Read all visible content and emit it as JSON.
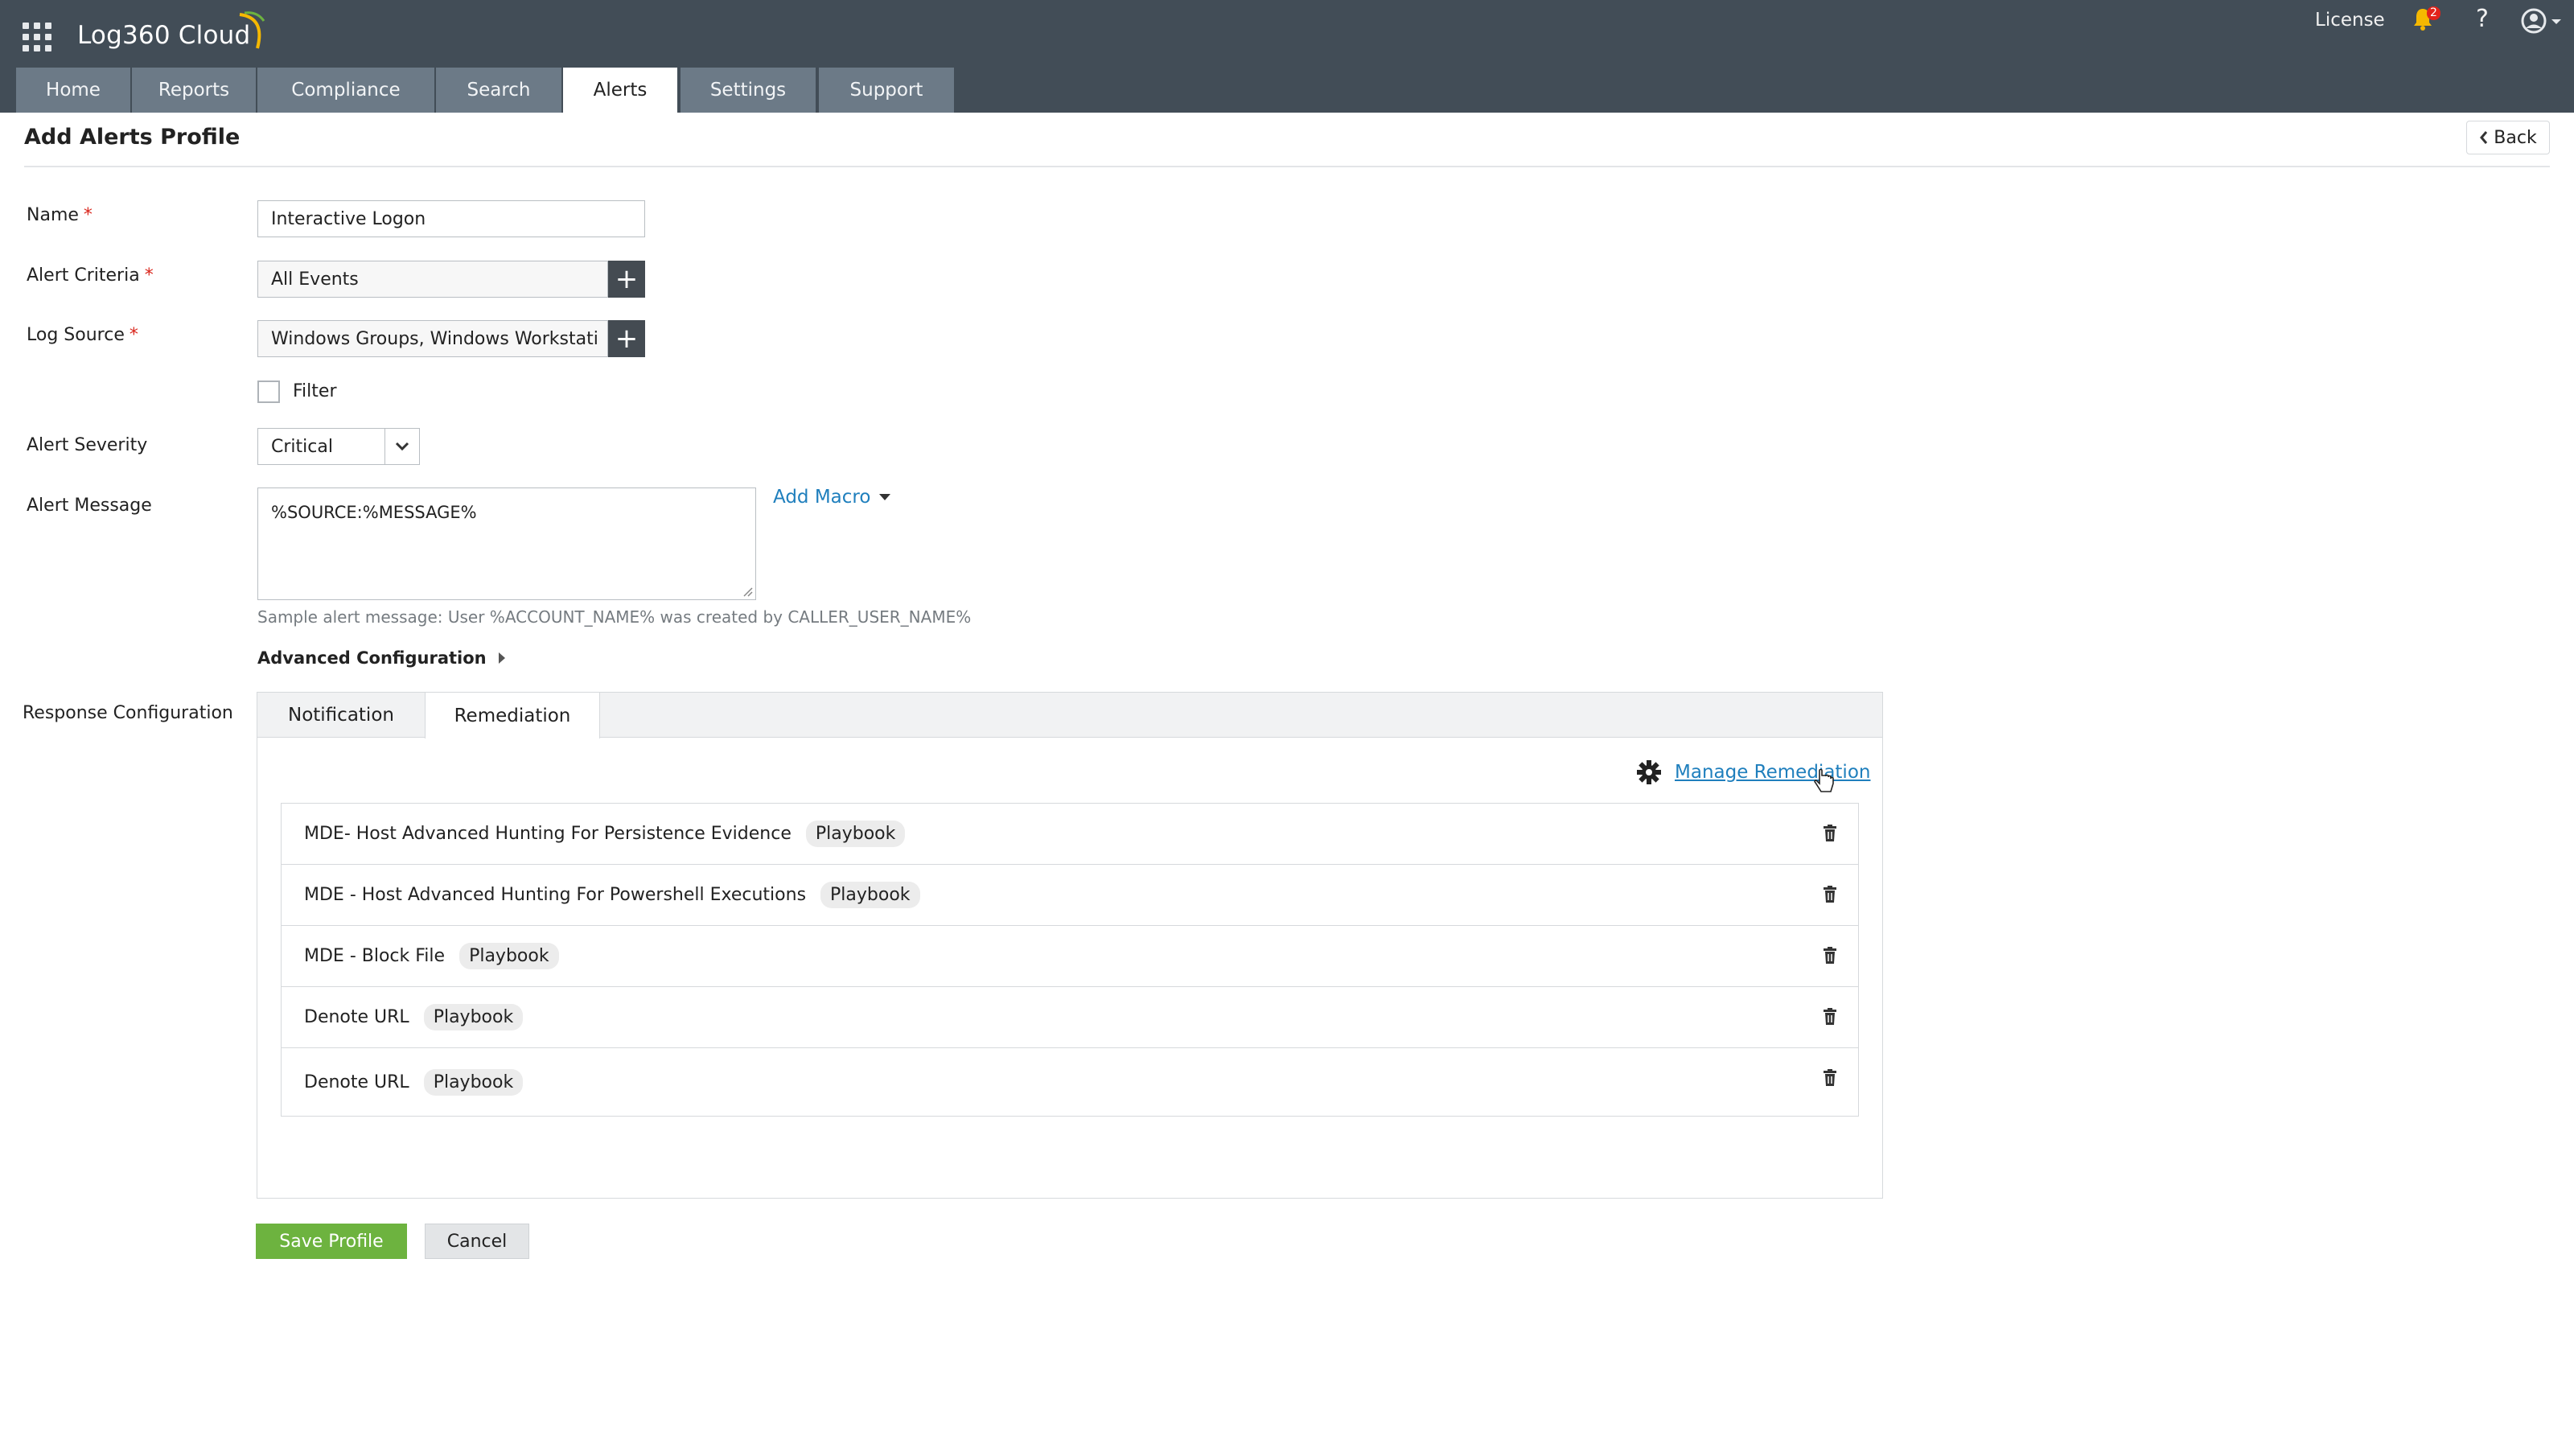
{
  "app": {
    "brand": "Log360 Cloud",
    "license_label": "License",
    "notification_count": "2",
    "help_label": "?"
  },
  "nav": {
    "tabs": [
      {
        "label": "Home"
      },
      {
        "label": "Reports"
      },
      {
        "label": "Compliance"
      },
      {
        "label": "Search"
      },
      {
        "label": "Alerts"
      },
      {
        "label": "Settings"
      },
      {
        "label": "Support"
      }
    ],
    "active_tab": "Alerts"
  },
  "page": {
    "title": "Add Alerts Profile",
    "back_label": "Back"
  },
  "form": {
    "name": {
      "label": "Name",
      "value": "Interactive Logon"
    },
    "alert_criteria": {
      "label": "Alert Criteria",
      "value": "All Events"
    },
    "log_source": {
      "label": "Log Source",
      "value": "Windows Groups, Windows Workstati"
    },
    "filter": {
      "label": "Filter",
      "checked": false
    },
    "alert_severity": {
      "label": "Alert Severity",
      "value": "Critical"
    },
    "alert_message": {
      "label": "Alert Message",
      "value": "%SOURCE:%MESSAGE%",
      "add_macro": "Add Macro",
      "hint": "Sample alert message: User %ACCOUNT_NAME% was created by CALLER_USER_NAME%"
    },
    "advanced_configuration": "Advanced Configuration",
    "required_mark": "*"
  },
  "response": {
    "label": "Response Configuration",
    "tabs": [
      {
        "label": "Notification"
      },
      {
        "label": "Remediation"
      }
    ],
    "active_tab": "Remediation",
    "manage_label": "Manage Remediation",
    "items": [
      {
        "name": "MDE- Host Advanced Hunting For Persistence Evidence",
        "tag": "Playbook"
      },
      {
        "name": "MDE - Host Advanced Hunting For Powershell Executions",
        "tag": "Playbook"
      },
      {
        "name": "MDE - Block File",
        "tag": "Playbook"
      },
      {
        "name": "Denote URL",
        "tag": "Playbook"
      },
      {
        "name": "Denote URL",
        "tag": "Playbook"
      }
    ]
  },
  "actions": {
    "save_label": "Save Profile",
    "cancel_label": "Cancel"
  },
  "colors": {
    "topbar": "#424d57",
    "tab_inactive": "#6c7a87",
    "link": "#1f7fbd",
    "save": "#6db33f",
    "required": "#d9261c"
  }
}
